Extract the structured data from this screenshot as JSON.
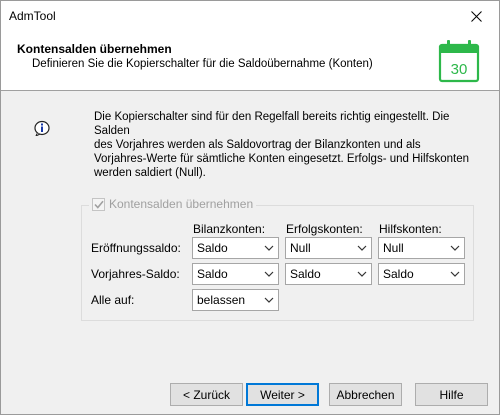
{
  "window": {
    "title": "AdmTool"
  },
  "header": {
    "title": "Kontensalden übernehmen",
    "subtitle": "Definieren Sie die Kopierschalter für die Saldoübernahme (Konten)",
    "calendar_day": "30"
  },
  "info": {
    "lines": [
      "Die Kopierschalter sind für den Regelfall bereits richtig eingestellt. Die Salden",
      "des Vorjahres werden als Saldovortrag der Bilanzkonten und als",
      "Vorjahres-Werte für sämtliche Konten eingesetzt. Erfolgs- und Hilfskonten",
      "werden saldiert (Null)."
    ]
  },
  "group": {
    "checkbox_label": "Kontensalden übernehmen",
    "checked": true,
    "columns": [
      "Bilanzkonten:",
      "Erfolgskonten:",
      "Hilfskonten:"
    ],
    "rows": [
      {
        "label": "Eröffnungssaldo:",
        "values": [
          "Saldo",
          "Null",
          "Null"
        ]
      },
      {
        "label": "Vorjahres-Saldo:",
        "values": [
          "Saldo",
          "Saldo",
          "Saldo"
        ]
      },
      {
        "label": "Alle auf:",
        "values": [
          "belassen"
        ]
      }
    ]
  },
  "buttons": {
    "back": "< Zurück",
    "next": "Weiter >",
    "cancel": "Abbrechen",
    "help": "Hilfe"
  },
  "colors": {
    "accent_green": "#2db84a",
    "default_button_border": "#0078d7"
  }
}
